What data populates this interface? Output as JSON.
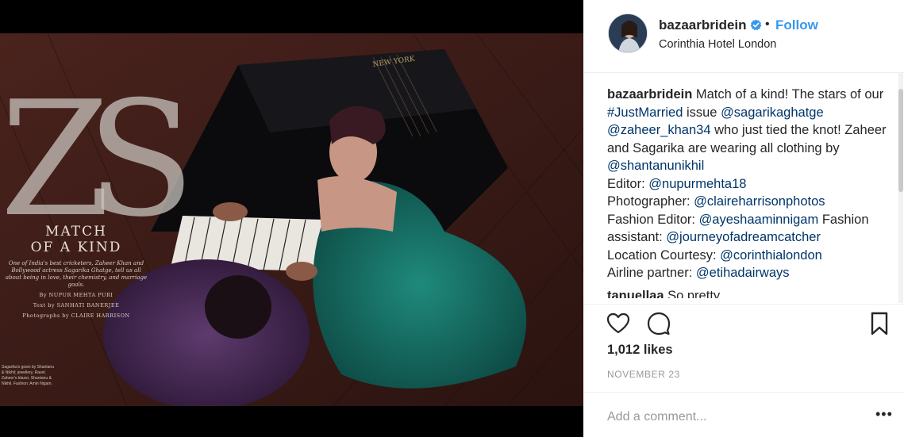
{
  "post": {
    "username": "bazaarbridein",
    "follow_label": "Follow",
    "separator": "•",
    "location": "Corinthia Hotel London"
  },
  "media": {
    "magazine_heading_line1": "MATCH",
    "magazine_heading_line2": "OF A KIND",
    "magazine_blurb": "One of India's best cricketers, Zaheer Khan and Bollywood actress Sagarika Ghatge, tell us all about being in love, their chemistry, and marriage goals.",
    "magazine_byline": "By NUPUR MEHTA PURI",
    "magazine_text_credit": "Text by SANHATI BANERJEE",
    "magazine_photo_credit": "Photographs by CLAIRE HARRISON",
    "big_letters": "ZS",
    "piano_brand": "NEW YORK",
    "corner_credit": "Sagarika's gown by Shantanu & Nikhil; jewellery, Ravel; Zaheer's blazer, Shantanu & Nikhil. Fashion: Amin Nigam."
  },
  "caption": {
    "username": "bazaarbridein",
    "t1": " Match of a kind! The stars of our ",
    "tag_justmarried": "#JustMarried",
    "t2": " issue ",
    "mention_sagarika": "@sagarikaghatge",
    "t3": " ",
    "mention_zaheer": "@zaheer_khan34",
    "t4": " who just tied the knot! Zaheer and Sagarika are wearing all clothing by ",
    "mention_shantanu": "@shantanunikhil",
    "editor_label": "Editor: ",
    "mention_editor": "@nupurmehta18",
    "photographer_label": "Photographer: ",
    "mention_photographer": "@claireharrisonphotos",
    "fashion_editor_label": "Fashion Editor: ",
    "mention_fashion_editor": "@ayeshaaminnigam",
    "fashion_assistant_label": " Fashion assistant: ",
    "mention_fashion_assistant": "@journeyofadreamcatcher",
    "location_label": "Location Courtesy: ",
    "mention_location": "@corinthialondon",
    "airline_label": "Airline partner: ",
    "mention_airline": "@etihadairways"
  },
  "next_comment": {
    "username": "tanuellaa",
    "text": " So pretty"
  },
  "stats": {
    "likes": "1,012 likes",
    "date": "NOVEMBER 23"
  },
  "comment_box": {
    "placeholder": "Add a comment...",
    "more_label": "•••"
  },
  "colors": {
    "accent": "#3897f0",
    "link": "#003569",
    "muted": "#999999"
  },
  "icons": {
    "like": "heart-icon",
    "comment": "comment-bubble-icon",
    "save": "bookmark-icon",
    "verified": "verified-badge-icon",
    "more": "more-options-icon"
  }
}
